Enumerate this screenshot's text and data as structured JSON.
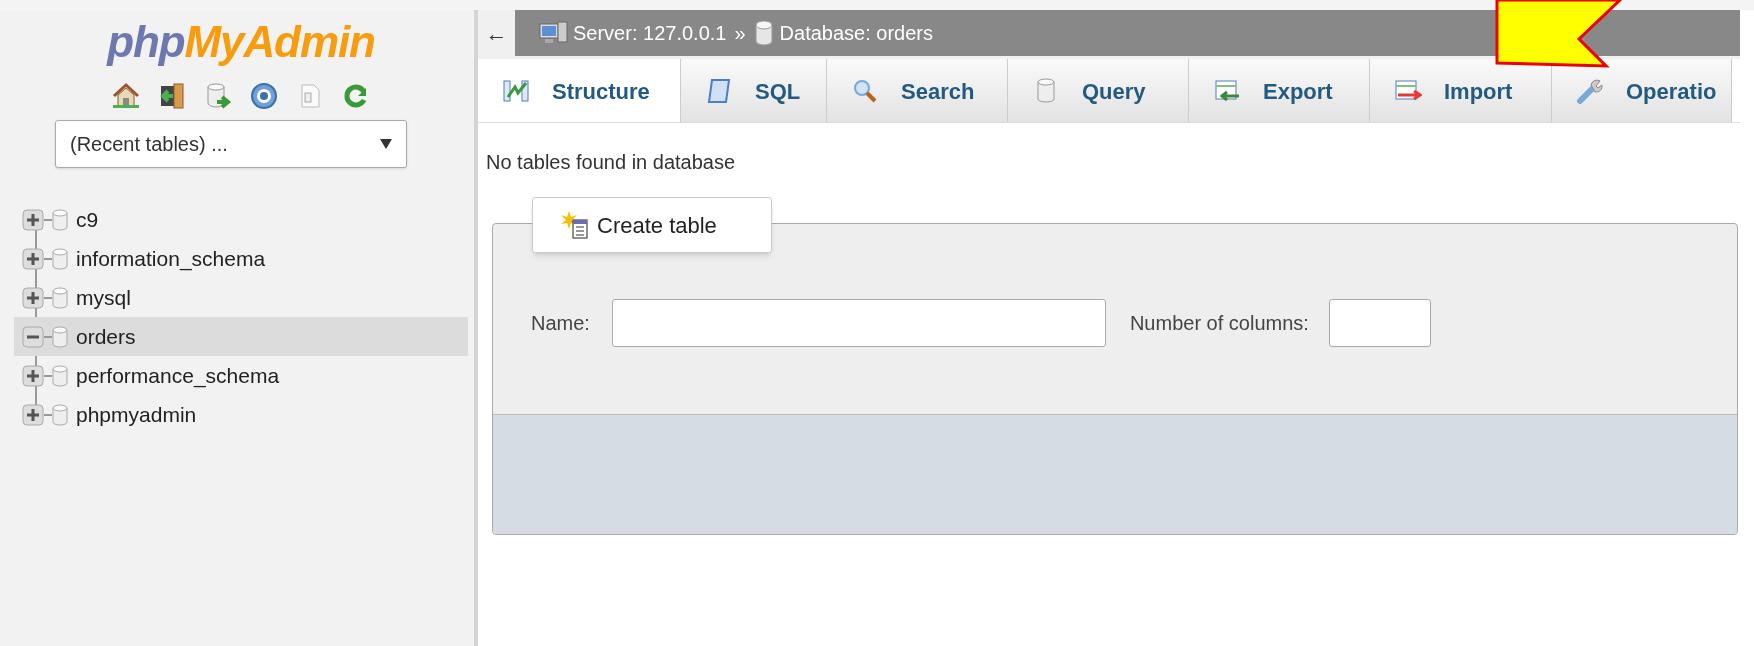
{
  "logo": {
    "part_1": "php",
    "part_2": "MyAdmin"
  },
  "recent_tables": {
    "value": "(Recent tables) ..."
  },
  "databases": [
    {
      "name": "c9",
      "expanded": false,
      "selected": false
    },
    {
      "name": "information_schema",
      "expanded": false,
      "selected": false
    },
    {
      "name": "mysql",
      "expanded": false,
      "selected": false
    },
    {
      "name": "orders",
      "expanded": true,
      "selected": true
    },
    {
      "name": "performance_schema",
      "expanded": false,
      "selected": false
    },
    {
      "name": "phpmyadmin",
      "expanded": false,
      "selected": false
    }
  ],
  "breadcrumb": {
    "back": "←",
    "server": "Server: 127.0.0.1",
    "separator": "»",
    "database": "Database: orders"
  },
  "tabs": [
    {
      "label": "Structure",
      "kind": "structure",
      "selected": true
    },
    {
      "label": "SQL",
      "kind": "sql",
      "selected": false
    },
    {
      "label": "Search",
      "kind": "search",
      "selected": false
    },
    {
      "label": "Query",
      "kind": "query",
      "selected": false
    },
    {
      "label": "Export",
      "kind": "export",
      "selected": false
    },
    {
      "label": "Import",
      "kind": "import",
      "selected": false
    },
    {
      "label": "Operatio",
      "kind": "operations",
      "selected": false
    }
  ],
  "message": "No tables found in database",
  "create_table": {
    "legend": "Create table",
    "name_label": "Name:",
    "columns_label": "Number of columns:"
  }
}
